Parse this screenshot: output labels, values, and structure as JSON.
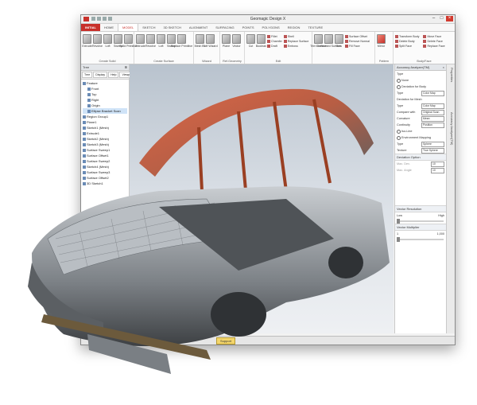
{
  "window": {
    "title": "Geomagic Design X"
  },
  "ribbon": {
    "tabs": [
      "INITIAL",
      "HOME",
      "MODEL",
      "SKETCH",
      "3D SKETCH",
      "ALIGNMENT",
      "SURFACING",
      "POINTS",
      "POLYGONS",
      "REGION",
      "TEXTURE"
    ],
    "active_tab": "MODEL",
    "groups": [
      {
        "name": "Create Solid",
        "tools": [
          "Extrude",
          "Revolve",
          "Loft",
          "Sweep",
          "Solid Primitive"
        ]
      },
      {
        "name": "Create Surface",
        "tools": [
          "Extrude",
          "Revolve",
          "Loft",
          "Sweep",
          "Surface Primitive"
        ]
      },
      {
        "name": "Wizard",
        "tools": [
          "Mesh Fit",
          "Loft Wizard"
        ]
      },
      {
        "name": "Ref.Geometry",
        "tools": [
          "Plane",
          "Vector"
        ]
      },
      {
        "name": "Edit",
        "tools": [
          "Cut",
          "Boolean"
        ],
        "small_tools": [
          "Fillet",
          "Chamfer",
          "Draft",
          "Shell",
          "Replace Surface",
          "Emboss"
        ]
      },
      {
        "name": "",
        "tools": [
          "Trim Surface",
          "Untrimmed Surface",
          "Sew"
        ],
        "small_tools": [
          "Surface Offset",
          "Remove Normal",
          "Fill Face"
        ]
      },
      {
        "name": "Pattern",
        "tools": [
          "Mirror"
        ]
      },
      {
        "name": "Body/Face",
        "small_tools": [
          "Transform Body",
          "Delete Body",
          "Split Face",
          "Move Face",
          "Delete Face",
          "Replace Face"
        ]
      }
    ]
  },
  "tree_panel": {
    "title": "Tree",
    "tabs": [
      "Tree",
      "Display",
      "Help",
      "Viewpt..."
    ],
    "items": [
      "Feature",
      "Front",
      "Top",
      "Right",
      "Origin",
      "Ellipse Bracket Scan",
      "Region Group1",
      "Plane1",
      "Sketch1 (Mesh)",
      "Extrude1",
      "Sketch2 (Mesh)",
      "Sketch3 (Mesh)",
      "Surface Sweep1",
      "Surface Offset1",
      "Surface Sweep2",
      "Sketch4 (Mesh)",
      "Surface Sweep3",
      "Surface Offset2",
      "3D Sketch1"
    ],
    "bottom_items": [
      "Ellipse Bracket Scan",
      "Solid Bodies",
      "Cube1"
    ]
  },
  "status": {
    "label": "Support"
  },
  "right_panel": {
    "title": "Accuracy Analyzer(TM)",
    "type_label": "Type",
    "type_options": [
      "None",
      "Deviation for Body"
    ],
    "rows": [
      {
        "label": "Type",
        "value": "Color Map"
      },
      {
        "label": "Deviation for Mesh",
        "value": ""
      },
      {
        "label": "Type",
        "value": "Color Map"
      },
      {
        "label": "Compare with",
        "value": "Original Scan"
      },
      {
        "label": "Curvature",
        "value": "Mean"
      },
      {
        "label": "Continuity",
        "value": "Position"
      }
    ],
    "extra": [
      "Iso-Line",
      "Environment Mapping"
    ],
    "env_rows": [
      {
        "label": "Type",
        "value": "Sphere"
      },
      {
        "label": "Texture",
        "value": "True Sphere"
      }
    ],
    "deviation_title": "Deviation Option",
    "deviation_rows": [
      {
        "label": "Max. Dev.",
        "value": "10"
      },
      {
        "label": "Max. Angle",
        "value": "10"
      }
    ],
    "vector_title": "Vector Resolution",
    "vector_labels": [
      "Low",
      "High"
    ],
    "multiplier_title": "Vector Multiplier",
    "multiplier_labels": [
      "1",
      "1,000"
    ]
  },
  "vtabs": [
    "Properties",
    "Accuracy Analyzer(TM)"
  ]
}
